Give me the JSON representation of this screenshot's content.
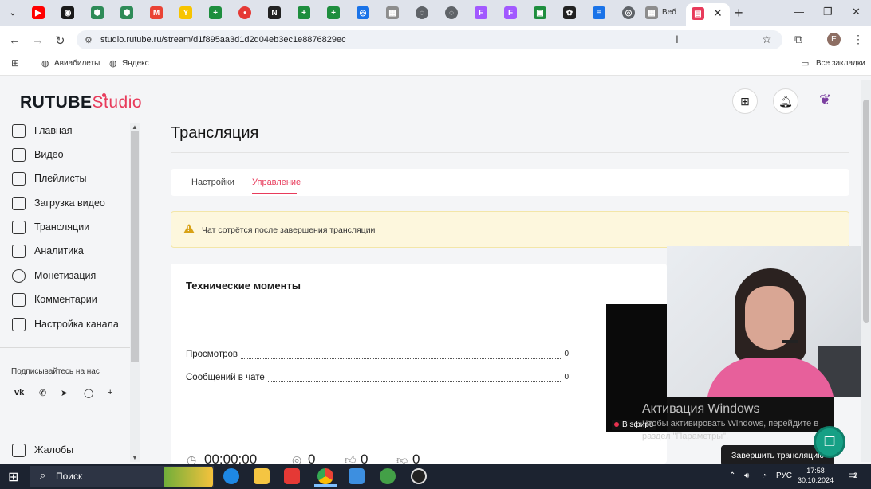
{
  "browser": {
    "tab_title": "Веб",
    "url": "studio.rutube.ru/stream/d1f895aa3d1d2d04eb3ec1e8876829ec",
    "bookmarks": [
      "Авиабилеты",
      "Яндекс"
    ],
    "all_bookmarks": "Все закладки",
    "profile_initial": "E"
  },
  "app": {
    "logo_main": "RUTUBE",
    "logo_sub": "Studio"
  },
  "sidebar": {
    "items": [
      {
        "label": "Главная",
        "icon": "home-icon"
      },
      {
        "label": "Видео",
        "icon": "video-icon"
      },
      {
        "label": "Плейлисты",
        "icon": "playlist-icon"
      },
      {
        "label": "Загрузка видео",
        "icon": "upload-icon"
      },
      {
        "label": "Трансляции",
        "icon": "broadcast-icon"
      },
      {
        "label": "Аналитика",
        "icon": "analytics-icon"
      },
      {
        "label": "Монетизация",
        "icon": "monetization-icon"
      },
      {
        "label": "Комментарии",
        "icon": "comments-icon"
      },
      {
        "label": "Настройка канала",
        "icon": "channel-settings-icon"
      }
    ],
    "follow_label": "Подписывайтесь на нас",
    "social": [
      "vk",
      "ok",
      "telegram",
      "viber",
      "more"
    ],
    "complaints": "Жалобы"
  },
  "main": {
    "title": "Трансляция",
    "tabs": [
      {
        "label": "Настройки",
        "active": false
      },
      {
        "label": "Управление",
        "active": true
      }
    ],
    "warning": "Чат сотрётся после завершения трансляции",
    "tech": {
      "title": "Технические моменты",
      "rows": [
        {
          "label": "Просмотров",
          "value": "0"
        },
        {
          "label": "Сообщений в чате",
          "value": "0"
        }
      ]
    },
    "bottom_stats": {
      "duration": "00:00:00",
      "viewers": "0",
      "likes": "0",
      "dislikes": "0"
    }
  },
  "player": {
    "live_label": "В эфире",
    "end_button": "Завершить трансляцию"
  },
  "watermark": {
    "line1": "Активация Windows",
    "line2": "Чтобы активировать Windows, перейдите в",
    "line3": "раздел \"Параметры\"."
  },
  "taskbar": {
    "search": "Поиск",
    "lang": "РУС",
    "time": "17:58",
    "date": "30.10.2024",
    "notifications": "2"
  },
  "colors": {
    "accent": "#e83b5b",
    "warning_bg": "#fdf7dd",
    "page_bg": "#f4f5f7"
  }
}
